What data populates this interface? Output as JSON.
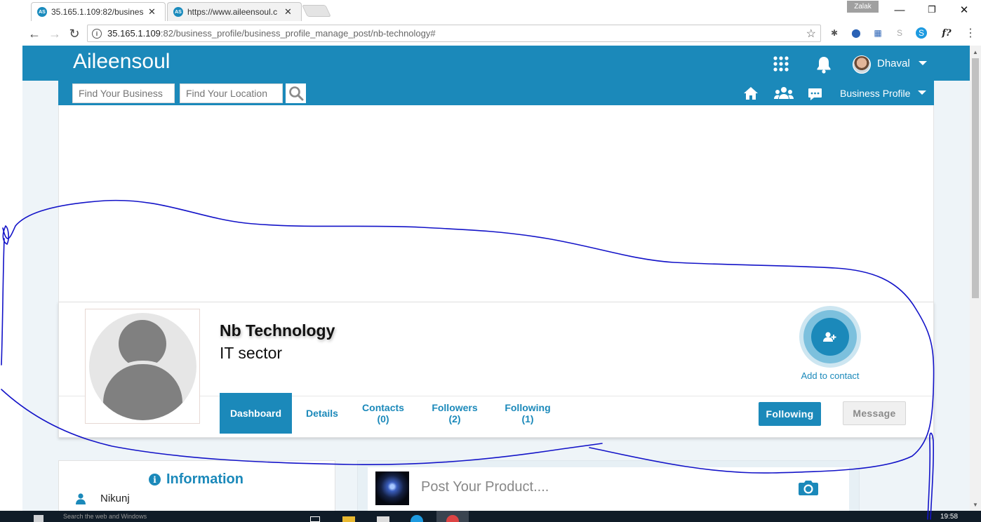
{
  "browser": {
    "tabs": [
      {
        "favicon": "AS",
        "title": "35.165.1.109:82/business"
      },
      {
        "favicon": "AS",
        "title": "https://www.aileensoul.c"
      }
    ],
    "os_user": "Zalak",
    "address": {
      "host": "35.165.1.109",
      "path": ":82/business_profile/business_profile_manage_post/nb-technology#"
    },
    "extensions": [
      "spider-icon",
      "download-icon",
      "printer-icon",
      "skype-gray-icon",
      "skype-icon",
      "f?"
    ]
  },
  "header": {
    "brand": "Aileensoul",
    "user_name": "Dhaval"
  },
  "search": {
    "business_placeholder": "Find Your Business",
    "location_placeholder": "Find Your Location"
  },
  "subnav": {
    "menu_label": "Business Profile"
  },
  "profile": {
    "company_name": "Nb Technology",
    "sector": "IT sector",
    "add_contact_label": "Add to contact"
  },
  "tabs": [
    {
      "label": "Dashboard",
      "count": ""
    },
    {
      "label": "Details",
      "count": ""
    },
    {
      "label": "Contacts",
      "count": "(0)"
    },
    {
      "label": "Followers",
      "count": "(2)"
    },
    {
      "label": "Following",
      "count": "(1)"
    }
  ],
  "actions": {
    "following_label": "Following",
    "message_label": "Message"
  },
  "information": {
    "title": "Information",
    "person": "Nikunj"
  },
  "post": {
    "placeholder": "Post Your Product...."
  },
  "taskbar": {
    "search_text": "Search the web and Windows",
    "time": "19:58"
  },
  "colors": {
    "brand_blue": "#1b89ba",
    "annotation_ink": "#1313c8"
  }
}
